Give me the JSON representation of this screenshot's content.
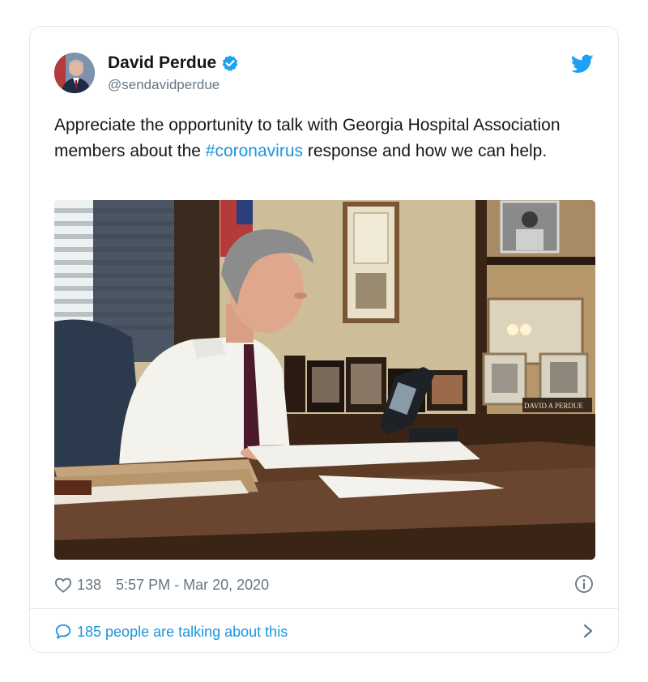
{
  "author": {
    "name": "David Perdue",
    "handle": "@sendavidperdue",
    "verified_icon": "verified-badge-icon",
    "avatar_icon": "avatar"
  },
  "tweet": {
    "text_before": "Appreciate the opportunity to talk with Georgia Hospital Association members about the ",
    "hashtag": "#coronavirus",
    "text_after": " response and how we can help."
  },
  "stats": {
    "likes": "138",
    "timestamp": "5:57 PM - Mar 20, 2020"
  },
  "footer": {
    "talking": "185 people are talking about this"
  },
  "media": {
    "nameplate": "DAVID A PERDUE"
  },
  "colors": {
    "accent": "#1b95e0",
    "twitter_blue": "#1da1f2",
    "secondary_text": "#657786",
    "border": "#e1e8ed"
  }
}
